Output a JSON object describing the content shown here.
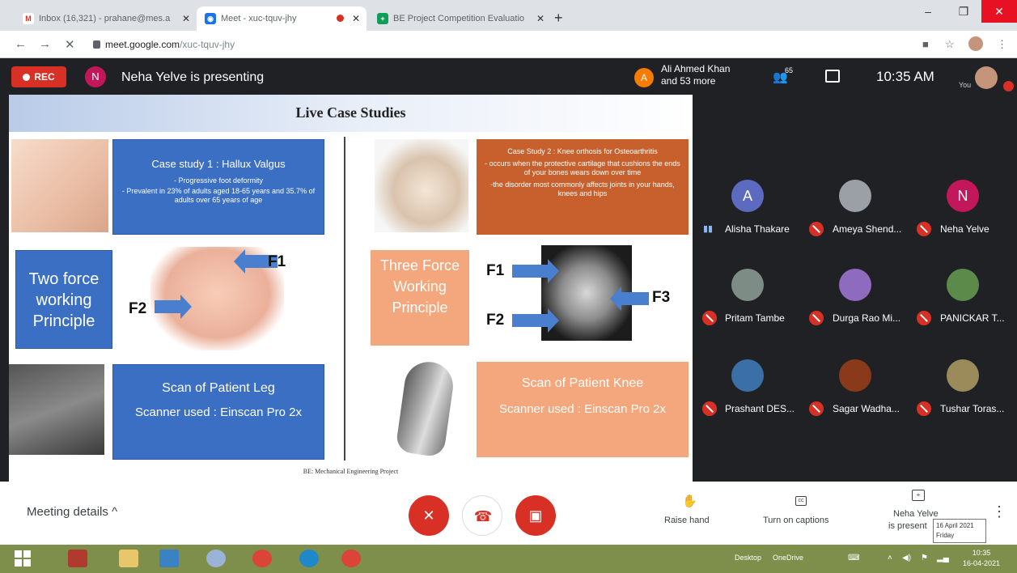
{
  "browser": {
    "tabs": [
      {
        "title": "Inbox (16,321) - prahane@mes.a",
        "icon": "gmail-icon",
        "color": "#d93025"
      },
      {
        "title": "Meet - xuc-tquv-jhy",
        "icon": "meet-icon",
        "color": "#1a73e8"
      },
      {
        "title": "BE Project Competition Evaluatio",
        "icon": "sheets-icon",
        "color": "#0f9d58"
      }
    ],
    "url_host": "meet.google.com",
    "url_path": "/xuc-tquv-jhy"
  },
  "meeting": {
    "rec_label": "REC",
    "presenter_initial": "N",
    "presenting_text": "Neha Yelve is presenting",
    "joined_initial": "A",
    "joined_line1": "Ali Ahmed Khan",
    "joined_line2": "and 53 more",
    "people_count": "65",
    "time": "10:35 AM",
    "you_label": "You"
  },
  "slide": {
    "title": "Live Case Studies",
    "case1_title": "Case study 1 : Hallux Valgus",
    "case1_line1": "- Progressive foot deformity",
    "case1_line2": "- Prevalent in 23% of adults aged 18-65 years and 35.7% of adults over 65 years of age",
    "two_force": "Two force working Principle",
    "scan_leg_title": "Scan of Patient Leg",
    "scan_leg_sub": "Scanner used : Einscan Pro 2x",
    "case2_title": "Case Study 2 : Knee orthosis for Osteoarthritis",
    "case2_line1": "- occurs when the protective cartilage that cushions the ends of your bones wears down over time",
    "case2_line2": "-the disorder most commonly affects joints in your hands, knees and hips",
    "three_force": "Three Force Working Principle",
    "scan_knee_title": "Scan of Patient Knee",
    "scan_knee_sub": "Scanner used : Einscan Pro 2x",
    "f1": "F1",
    "f2": "F2",
    "f3": "F3",
    "footer": "BE: Mechanical Engineering Project"
  },
  "participants": [
    {
      "name": "Alisha Thakare",
      "initial": "A",
      "color": "#5c6bc0",
      "status": "speaking"
    },
    {
      "name": "Ameya Shend...",
      "initial": "",
      "color": "#9aa0a6",
      "status": "muted"
    },
    {
      "name": "Neha Yelve",
      "initial": "N",
      "color": "#c2185b",
      "status": "muted"
    },
    {
      "name": "Pritam Tambe",
      "initial": "",
      "color": "#7d8c84",
      "status": "muted"
    },
    {
      "name": "Durga Rao Mi...",
      "initial": "",
      "color": "#8e6bbf",
      "status": "muted"
    },
    {
      "name": "PANICKAR T...",
      "initial": "",
      "color": "#5b8a4a",
      "status": "muted"
    },
    {
      "name": "Prashant DES...",
      "initial": "",
      "color": "#3b6fa8",
      "status": "muted"
    },
    {
      "name": "Sagar Wadha...",
      "initial": "",
      "color": "#8a3a1a",
      "status": "muted"
    },
    {
      "name": "Tushar Toras...",
      "initial": "",
      "color": "#9b8a5a",
      "status": "muted"
    }
  ],
  "bottom": {
    "meeting_details": "Meeting details",
    "raise_hand": "Raise hand",
    "captions": "Turn on captions",
    "present_line1": "Neha Yelve",
    "present_line2": "is present"
  },
  "tooltip": {
    "date": "16 April 2021",
    "day": "Friday"
  },
  "taskbar": {
    "desktop": "Desktop",
    "onedrive": "OneDrive",
    "time": "10:35",
    "date": "16-04-2021"
  }
}
